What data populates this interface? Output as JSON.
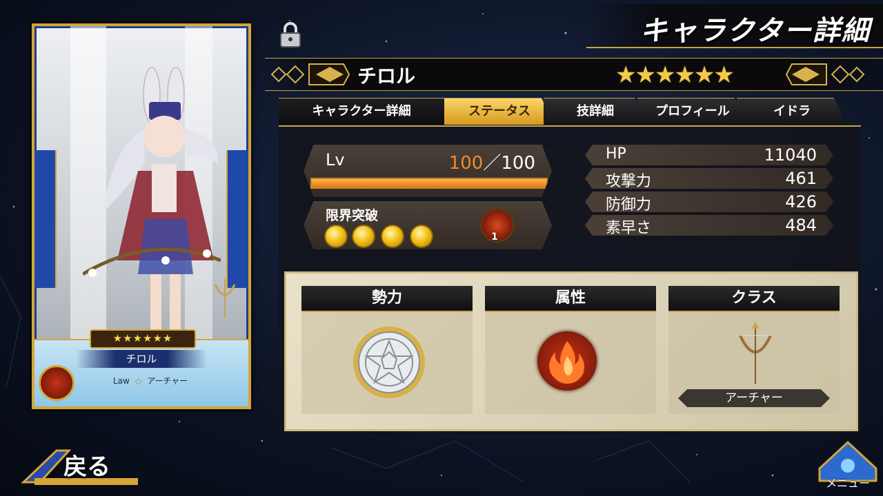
{
  "header": {
    "title": "キャラクター詳細"
  },
  "character": {
    "name": "チロル",
    "rarity_stars": "★★★★★★"
  },
  "card": {
    "name": "チロル",
    "stars": "★★★★★★",
    "faction": "Law",
    "separator": "◇",
    "class": "アーチャー"
  },
  "tabs": [
    {
      "label": "キャラクター詳細"
    },
    {
      "label": "ステータス"
    },
    {
      "label": "技詳細"
    },
    {
      "label": "プロフィール"
    },
    {
      "label": "イドラ"
    }
  ],
  "level": {
    "label": "Lv",
    "current": "100",
    "max": "／100",
    "progress": 1.0
  },
  "limit_break": {
    "label": "限界突破",
    "count": "1",
    "orbs_filled": 4
  },
  "stats": [
    {
      "key": "HP",
      "value": "11040"
    },
    {
      "key": "攻撃力",
      "value": "461"
    },
    {
      "key": "防御力",
      "value": "426"
    },
    {
      "key": "素早さ",
      "value": "484"
    }
  ],
  "info": {
    "faction_label": "勢力",
    "element_label": "属性",
    "class_label": "クラス",
    "class_value": "アーチャー"
  },
  "nav": {
    "back": "戻る",
    "menu": "メニュー"
  },
  "colors": {
    "gold": "#c9a24a",
    "level_orange": "#f08a2a",
    "active_tab": "#f9d56a",
    "fire": "#c53414"
  }
}
